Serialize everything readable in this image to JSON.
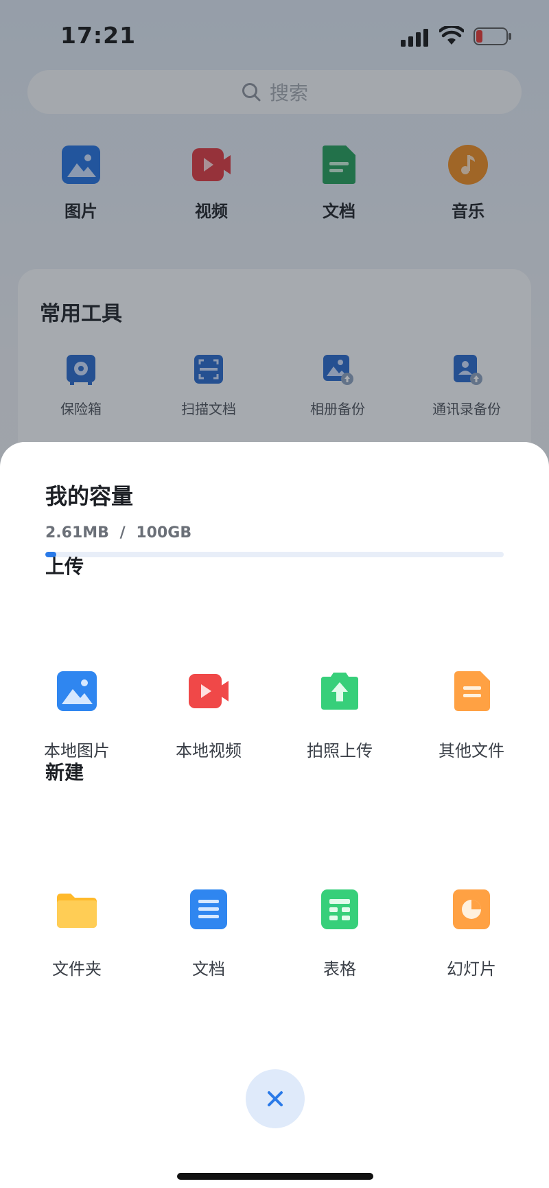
{
  "status_bar": {
    "time": "17:21",
    "icons": [
      "cellular-signal-icon",
      "wifi-icon",
      "battery-low-icon"
    ]
  },
  "search": {
    "placeholder": "搜索"
  },
  "categories": [
    {
      "label": "图片",
      "icon": "image-icon",
      "color": "#1f6fe0"
    },
    {
      "label": "视频",
      "icon": "video-icon",
      "color": "#e0353b"
    },
    {
      "label": "文档",
      "icon": "document-icon",
      "color": "#1f9d55"
    },
    {
      "label": "音乐",
      "icon": "music-icon",
      "color": "#f08a1c"
    }
  ],
  "tools": {
    "title": "常用工具",
    "items": [
      {
        "label": "保险箱",
        "icon": "safe-icon"
      },
      {
        "label": "扫描文档",
        "icon": "scan-icon"
      },
      {
        "label": "相册备份",
        "icon": "album-backup-icon"
      },
      {
        "label": "通讯录备份",
        "icon": "contacts-backup-icon"
      }
    ]
  },
  "sheet": {
    "capacity": {
      "title": "我的容量",
      "used": "2.61MB",
      "separator": "/",
      "total": "100GB",
      "used_fraction": 2.55e-05
    },
    "upload": {
      "title": "上传",
      "items": [
        {
          "label": "本地图片",
          "icon": "local-image-icon",
          "color": "#2f86f0"
        },
        {
          "label": "本地视频",
          "icon": "local-video-icon",
          "color": "#f04848"
        },
        {
          "label": "拍照上传",
          "icon": "camera-upload-icon",
          "color": "#37cf7a"
        },
        {
          "label": "其他文件",
          "icon": "other-file-icon",
          "color": "#ffa143"
        }
      ]
    },
    "create": {
      "title": "新建",
      "items": [
        {
          "label": "文件夹",
          "icon": "folder-icon",
          "color": "#ffc23d"
        },
        {
          "label": "文档",
          "icon": "new-document-icon",
          "color": "#2f86f0"
        },
        {
          "label": "表格",
          "icon": "spreadsheet-icon",
          "color": "#37cf7a"
        },
        {
          "label": "幻灯片",
          "icon": "slides-icon",
          "color": "#ffa143"
        }
      ]
    },
    "close_icon": "close-icon"
  }
}
